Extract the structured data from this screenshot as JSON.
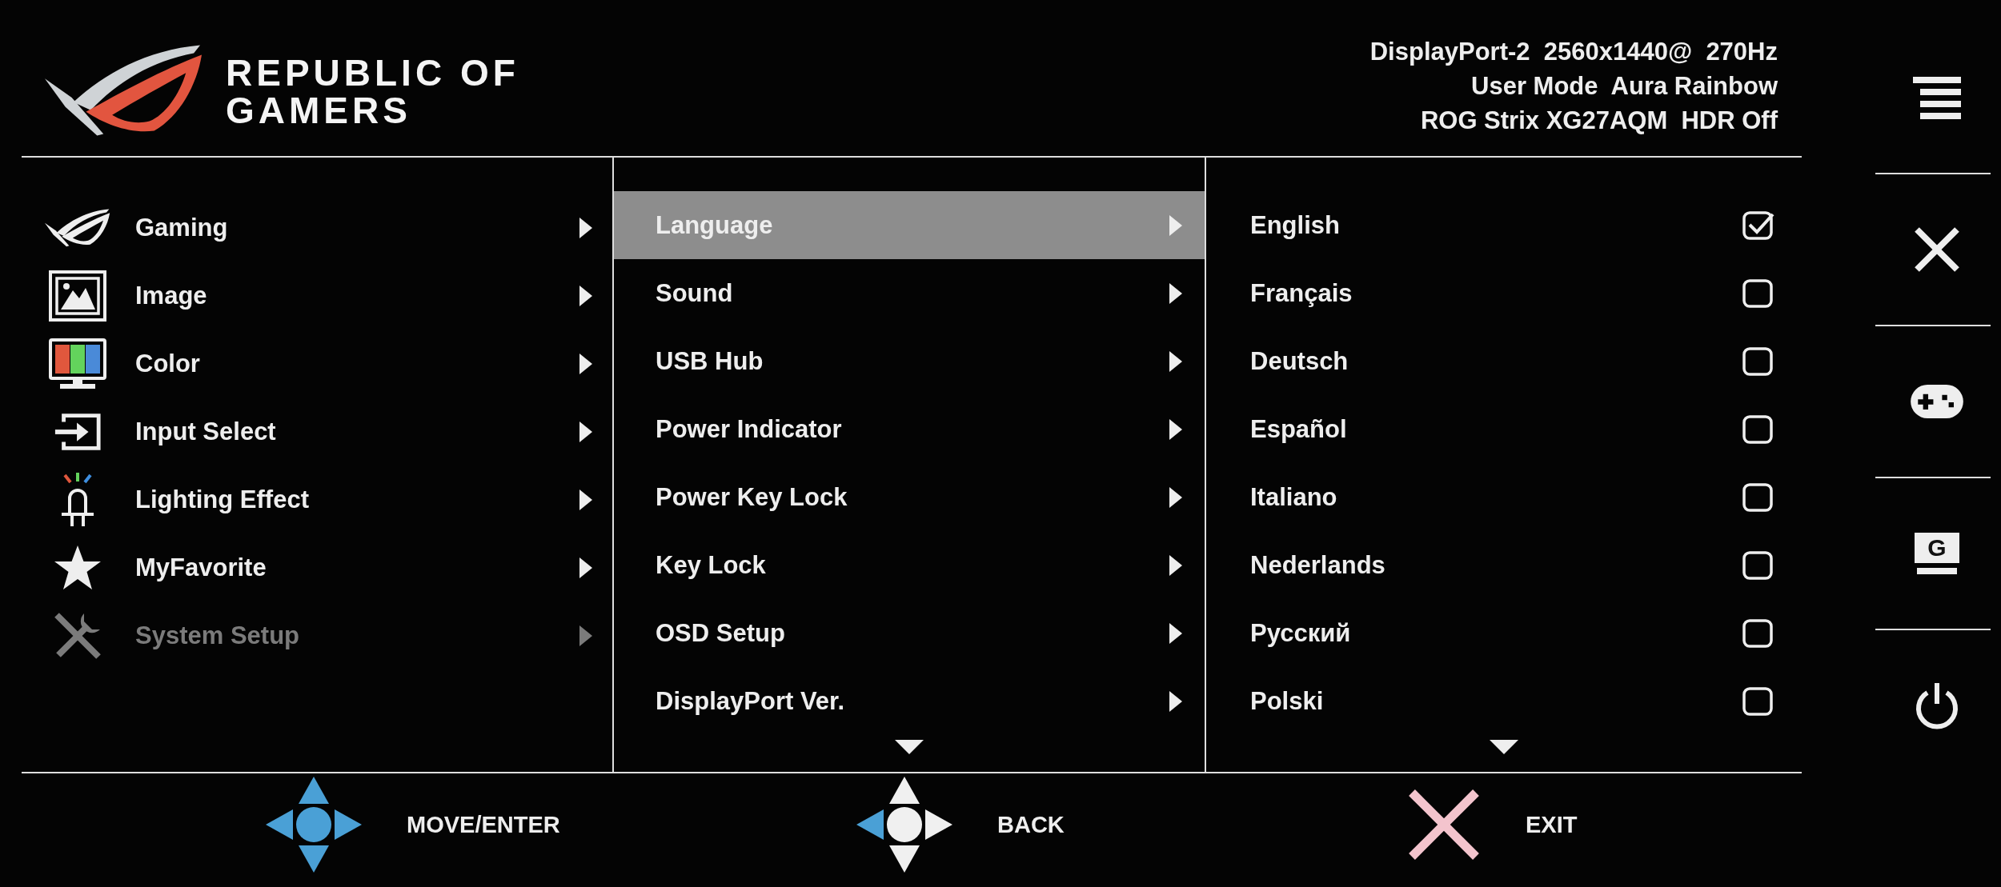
{
  "brand": {
    "lines": [
      "REPUBLIC OF",
      "GAMERS"
    ]
  },
  "status_lines": [
    "DisplayPort-2  2560x1440@  270Hz",
    "User Mode  Aura Rainbow",
    "ROG Strix XG27AQM  HDR Off"
  ],
  "main_menu": [
    {
      "label": "Gaming",
      "selected": false
    },
    {
      "label": "Image",
      "selected": false
    },
    {
      "label": "Color",
      "selected": false
    },
    {
      "label": "Input Select",
      "selected": false
    },
    {
      "label": "Lighting Effect",
      "selected": false
    },
    {
      "label": "MyFavorite",
      "selected": false
    },
    {
      "label": "System Setup",
      "selected": true
    }
  ],
  "submenu": [
    {
      "label": "Language",
      "selected": true
    },
    {
      "label": "Sound",
      "selected": false
    },
    {
      "label": "USB Hub",
      "selected": false
    },
    {
      "label": "Power Indicator",
      "selected": false
    },
    {
      "label": "Power Key Lock",
      "selected": false
    },
    {
      "label": "Key Lock",
      "selected": false
    },
    {
      "label": "OSD Setup",
      "selected": false
    },
    {
      "label": "DisplayPort Ver.",
      "selected": false
    }
  ],
  "languages": [
    {
      "label": "English",
      "checked": true
    },
    {
      "label": "Français",
      "checked": false
    },
    {
      "label": "Deutsch",
      "checked": false
    },
    {
      "label": "Español",
      "checked": false
    },
    {
      "label": "Italiano",
      "checked": false
    },
    {
      "label": "Nederlands",
      "checked": false
    },
    {
      "label": "Русский",
      "checked": false
    },
    {
      "label": "Polski",
      "checked": false
    }
  ],
  "side_buttons": [
    {
      "kind": "menu"
    },
    {
      "kind": "close"
    },
    {
      "kind": "gamepad"
    },
    {
      "kind": "screen",
      "letter": "G"
    },
    {
      "kind": "power"
    }
  ],
  "footer_hints": [
    "MOVE/ENTER",
    "BACK",
    "EXIT"
  ]
}
